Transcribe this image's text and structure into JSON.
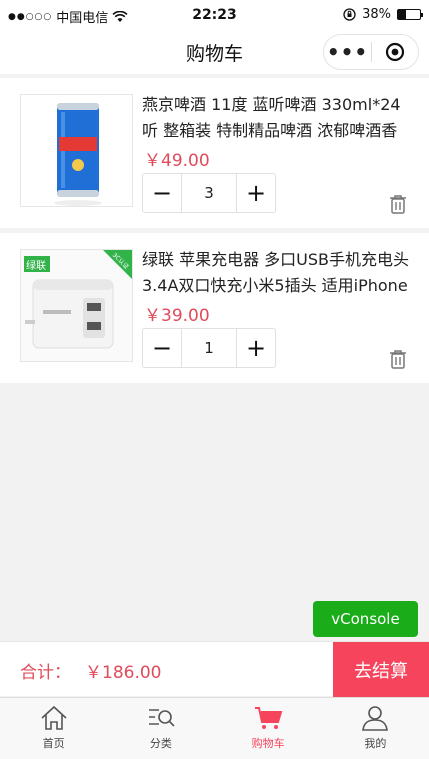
{
  "status_bar": {
    "carrier": "中国电信",
    "time": "22:23",
    "battery": "38%",
    "battery_level": 0.38
  },
  "nav": {
    "title": "购物车",
    "more_icon": "more-dots-icon",
    "close_icon": "target-icon"
  },
  "items": [
    {
      "name": "燕京啤酒 11度 蓝听啤酒 330ml*24听 整箱装 特制精品啤酒 浓郁啤酒香",
      "price": "￥49.00",
      "quantity": "3",
      "image_icon": "beer-can-image"
    },
    {
      "name": "绿联 苹果充电器 多口USB手机充电头 3.4A双口快充小米5插头 适用iPhone",
      "price": "￥39.00",
      "quantity": "1",
      "image_icon": "usb-charger-image",
      "brand_badge": "绿联",
      "promo_badge": "3C认证"
    }
  ],
  "stepper": {
    "minus": "−",
    "plus": "+"
  },
  "vconsole": "vConsole",
  "checkout": {
    "total_label": "合计：",
    "total_amount": "￥186.00",
    "button": "去结算"
  },
  "tabbar": [
    {
      "label": "首页",
      "icon": "home-icon"
    },
    {
      "label": "分类",
      "icon": "category-icon"
    },
    {
      "label": "购物车",
      "icon": "cart-icon",
      "active": true
    },
    {
      "label": "我的",
      "icon": "profile-icon"
    }
  ],
  "colors": {
    "accent": "#f5445c",
    "price": "#e04b5b",
    "vconsole": "#1aad19"
  }
}
